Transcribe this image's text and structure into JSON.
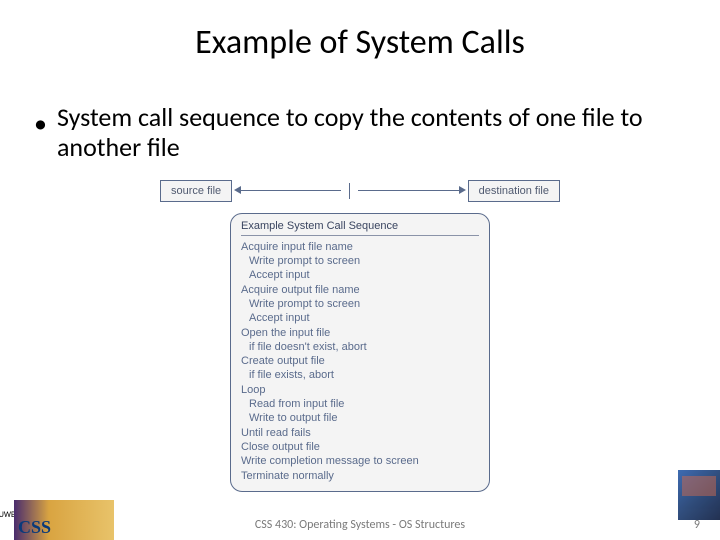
{
  "title": "Example of System Calls",
  "bullet": "System call sequence to copy the contents of one file to another file",
  "diagram": {
    "source_label": "source file",
    "dest_label": "destination  file",
    "seq_title": "Example System Call Sequence",
    "lines": [
      {
        "t": "Acquire input file name",
        "i": 0
      },
      {
        "t": "Write prompt to screen",
        "i": 1
      },
      {
        "t": "Accept input",
        "i": 1
      },
      {
        "t": "Acquire output file name",
        "i": 0
      },
      {
        "t": "Write prompt to screen",
        "i": 1
      },
      {
        "t": "Accept input",
        "i": 1
      },
      {
        "t": "Open the input file",
        "i": 0
      },
      {
        "t": "if file doesn't exist, abort",
        "i": 1
      },
      {
        "t": "Create output file",
        "i": 0
      },
      {
        "t": "if file exists, abort",
        "i": 1
      },
      {
        "t": "Loop",
        "i": 0
      },
      {
        "t": "Read from input file",
        "i": 1
      },
      {
        "t": "Write to output file",
        "i": 1
      },
      {
        "t": "Until read fails",
        "i": 0
      },
      {
        "t": "Close output file",
        "i": 0
      },
      {
        "t": "Write completion message to screen",
        "i": 0
      },
      {
        "t": "Terminate normally",
        "i": 0
      }
    ]
  },
  "footer": "CSS 430: Operating Systems - OS Structures",
  "page": "9",
  "logo_left_text": "CSS",
  "uwb_text": "UWB"
}
